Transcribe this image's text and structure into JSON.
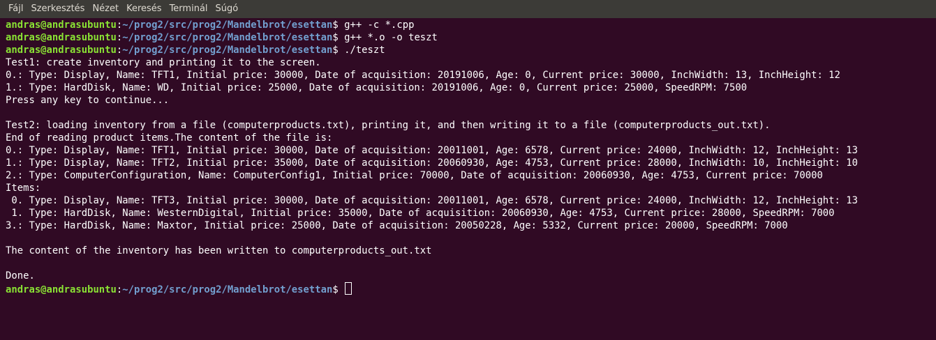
{
  "menu": {
    "items": [
      "Fájl",
      "Szerkesztés",
      "Nézet",
      "Keresés",
      "Terminál",
      "Súgó"
    ]
  },
  "terminal": {
    "user_host": "andras@andrasubuntu",
    "cwd": "~/prog2/src/prog2/Mandelbrot/esettan",
    "prompt_symbol": "$ ",
    "lines": [
      {
        "kind": "cmd",
        "text": "g++ -c *.cpp"
      },
      {
        "kind": "cmd",
        "text": "g++ *.o -o teszt"
      },
      {
        "kind": "cmd",
        "text": "./teszt"
      },
      {
        "kind": "out",
        "text": "Test1: create inventory and printing it to the screen."
      },
      {
        "kind": "out",
        "text": "0.: Type: Display, Name: TFT1, Initial price: 30000, Date of acquisition: 20191006, Age: 0, Current price: 30000, InchWidth: 13, InchHeight: 12"
      },
      {
        "kind": "out",
        "text": "1.: Type: HardDisk, Name: WD, Initial price: 25000, Date of acquisition: 20191006, Age: 0, Current price: 25000, SpeedRPM: 7500"
      },
      {
        "kind": "out",
        "text": "Press any key to continue..."
      },
      {
        "kind": "out",
        "text": ""
      },
      {
        "kind": "out",
        "text": "Test2: loading inventory from a file (computerproducts.txt), printing it, and then writing it to a file (computerproducts_out.txt)."
      },
      {
        "kind": "out",
        "text": "End of reading product items.The content of the file is:"
      },
      {
        "kind": "out",
        "text": "0.: Type: Display, Name: TFT1, Initial price: 30000, Date of acquisition: 20011001, Age: 6578, Current price: 24000, InchWidth: 12, InchHeight: 13"
      },
      {
        "kind": "out",
        "text": "1.: Type: Display, Name: TFT2, Initial price: 35000, Date of acquisition: 20060930, Age: 4753, Current price: 28000, InchWidth: 10, InchHeight: 10"
      },
      {
        "kind": "out",
        "text": "2.: Type: ComputerConfiguration, Name: ComputerConfig1, Initial price: 70000, Date of acquisition: 20060930, Age: 4753, Current price: 70000"
      },
      {
        "kind": "out",
        "text": "Items:"
      },
      {
        "kind": "out",
        "text": " 0. Type: Display, Name: TFT3, Initial price: 30000, Date of acquisition: 20011001, Age: 6578, Current price: 24000, InchWidth: 12, InchHeight: 13"
      },
      {
        "kind": "out",
        "text": " 1. Type: HardDisk, Name: WesternDigital, Initial price: 35000, Date of acquisition: 20060930, Age: 4753, Current price: 28000, SpeedRPM: 7000"
      },
      {
        "kind": "out",
        "text": "3.: Type: HardDisk, Name: Maxtor, Initial price: 25000, Date of acquisition: 20050228, Age: 5332, Current price: 20000, SpeedRPM: 7000"
      },
      {
        "kind": "out",
        "text": ""
      },
      {
        "kind": "out",
        "text": "The content of the inventory has been written to computerproducts_out.txt"
      },
      {
        "kind": "out",
        "text": ""
      },
      {
        "kind": "out",
        "text": "Done."
      },
      {
        "kind": "cmd",
        "text": ""
      }
    ]
  }
}
